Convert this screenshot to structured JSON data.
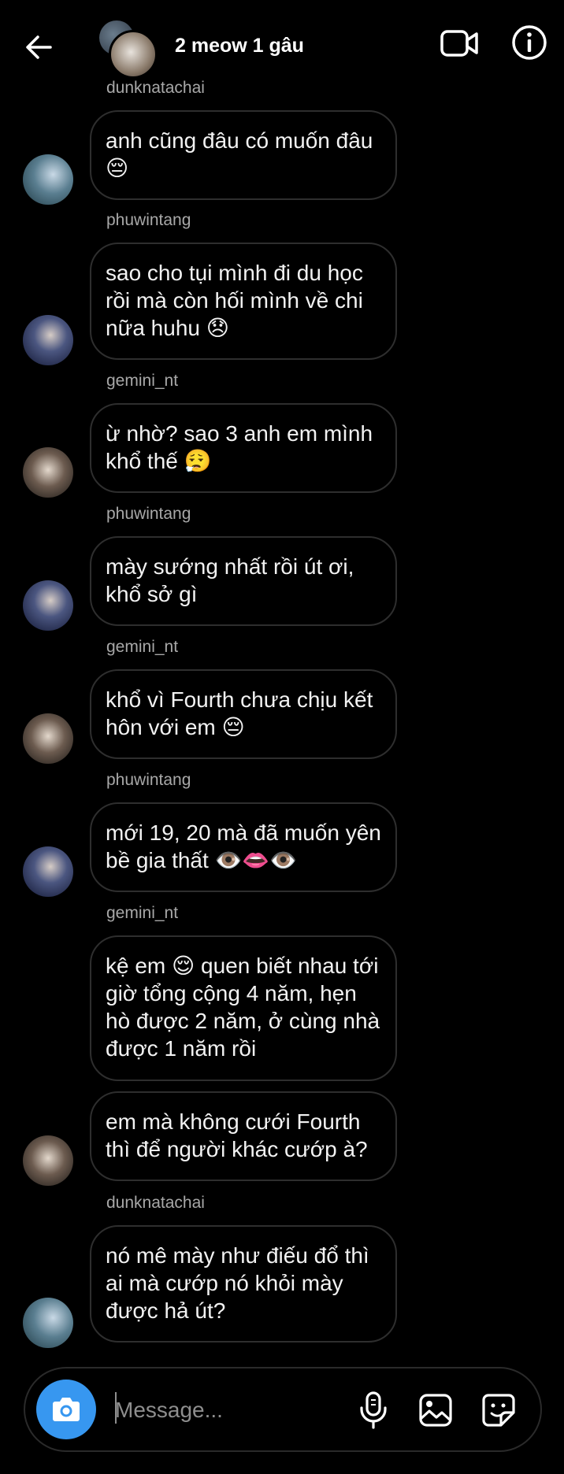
{
  "header": {
    "title": "2 meow 1 gâu",
    "back_icon": "arrow-left-icon",
    "video_icon": "video-camera-icon",
    "info_icon": "info-icon"
  },
  "messages": [
    {
      "sender": "dunknatachai",
      "text": "anh cũng đâu có muốn đâu 😔",
      "avatar": "dunk"
    },
    {
      "sender": "phuwintang",
      "text": "sao cho tụi mình đi du học rồi mà còn hối mình về chi nữa huhu 😞",
      "avatar": "phuwin"
    },
    {
      "sender": "gemini_nt",
      "text": "ừ nhờ? sao 3 anh em mình khổ thế 😮‍💨",
      "avatar": "gemini"
    },
    {
      "sender": "phuwintang",
      "text": "mày sướng nhất rồi út ơi, khổ sở gì",
      "avatar": "phuwin"
    },
    {
      "sender": "gemini_nt",
      "text": "khổ vì Fourth chưa chịu kết hôn với em 😔",
      "avatar": "gemini"
    },
    {
      "sender": "phuwintang",
      "text": "mới 19, 20 mà đã muốn yên bề gia thất 👁️👄👁️",
      "avatar": "phuwin"
    },
    {
      "sender": "gemini_nt",
      "text": "kệ em 😌 quen biết nhau tới giờ tổng cộng 4 năm, hẹn hò được 2 năm, ở cùng nhà được 1 năm rồi",
      "avatar": null
    },
    {
      "sender": null,
      "text": "em mà không cưới Fourth thì để người khác cướp à?",
      "avatar": "gemini"
    },
    {
      "sender": "dunknatachai",
      "text": "nó mê mày như điếu đổ thì ai mà cướp nó khỏi mày được hả út?",
      "avatar": "dunk"
    }
  ],
  "composer": {
    "placeholder": "Message...",
    "camera_icon": "camera-icon",
    "mic_icon": "microphone-icon",
    "gallery_icon": "image-gallery-icon",
    "sticker_icon": "sticker-icon",
    "accent": "#3797f0"
  }
}
